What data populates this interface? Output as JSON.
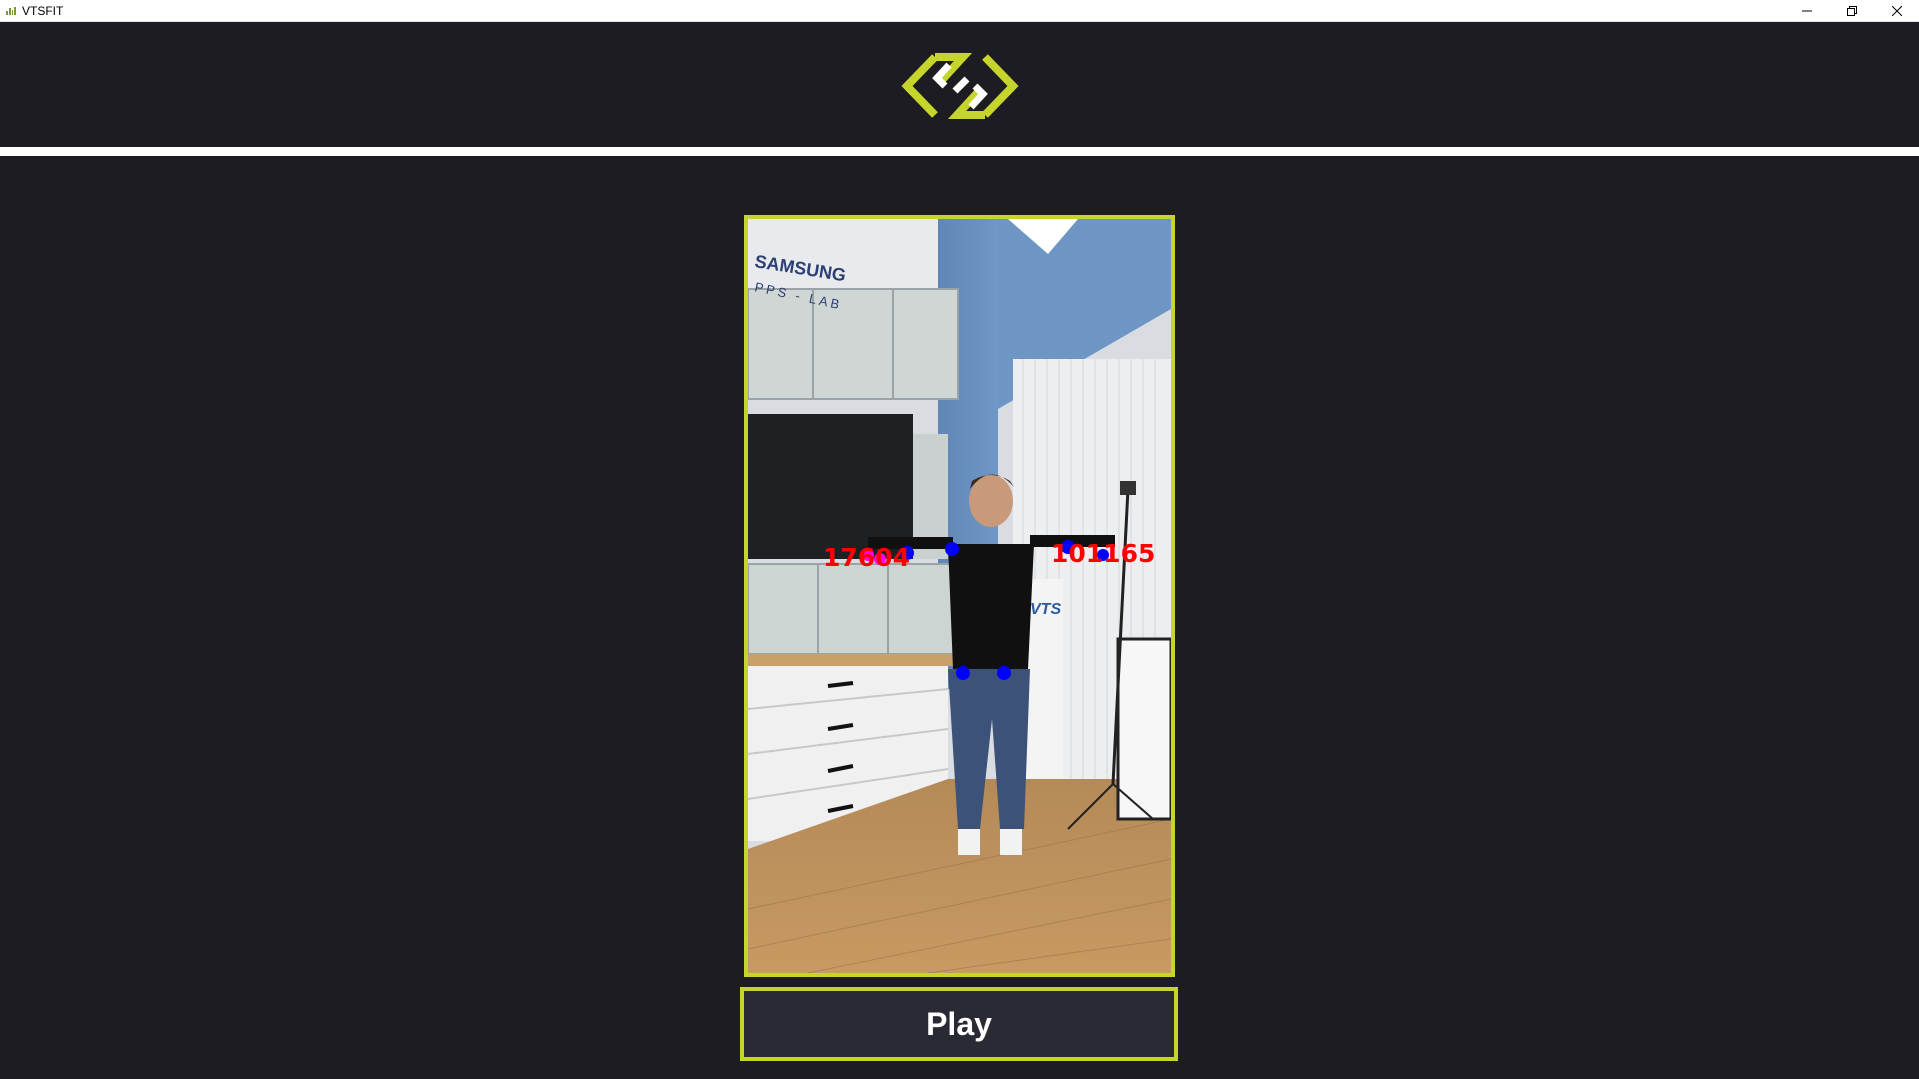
{
  "window": {
    "title": "VTSFIT",
    "controls": [
      "minimize",
      "restore",
      "close"
    ]
  },
  "colors": {
    "accent": "#c6d52b",
    "background": "#1c1c22",
    "button_bg": "#292a34",
    "divider": "#ffffff",
    "keypoint": "#0000ff",
    "angle_text": "#ff0000"
  },
  "logo": {
    "icon": "vtsfit-logo-icon"
  },
  "video": {
    "scene_text": {
      "brand": "SAMSUNG",
      "lab": "PPS - LAB",
      "box": "VTS"
    },
    "overlay_labels": {
      "left_angle": "17604",
      "right_angle": "101165"
    }
  },
  "play_button": {
    "label": "Play"
  }
}
